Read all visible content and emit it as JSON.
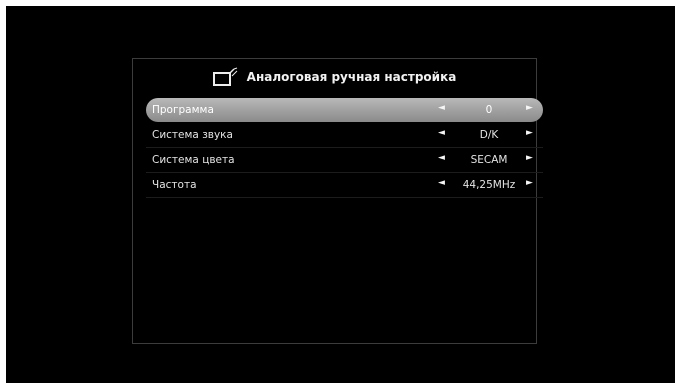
{
  "header": {
    "title": "Аналоговая ручная настройка",
    "icon": "tv-antenna-icon"
  },
  "rows": [
    {
      "label": "Программа",
      "value": "0",
      "selected": true
    },
    {
      "label": "Система звука",
      "value": "D/K",
      "selected": false
    },
    {
      "label": "Система цвета",
      "value": "SECAM",
      "selected": false
    },
    {
      "label": "Частота",
      "value": "44,25MHz",
      "selected": false
    }
  ],
  "arrows": {
    "left": "◄",
    "right": "►"
  },
  "colors": {
    "background": "#000000",
    "selected_row": "#a0a0a0",
    "text": "#e4e4e4",
    "panel_border": "#3c3c3c"
  }
}
